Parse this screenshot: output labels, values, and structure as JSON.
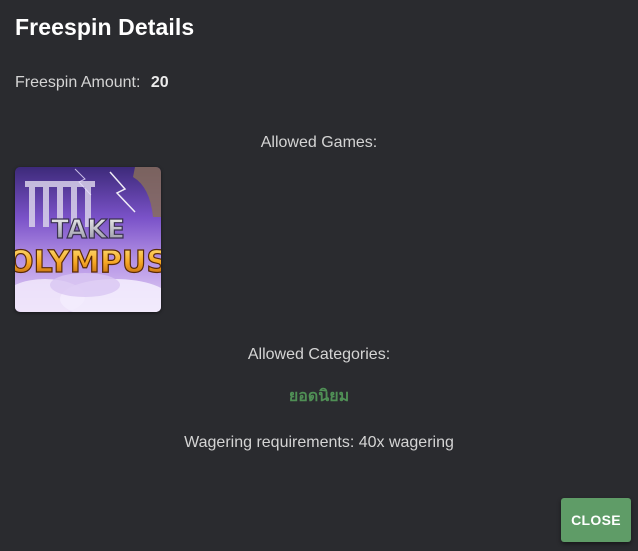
{
  "modal": {
    "title": "Freespin Details",
    "amount_label": "Freespin Amount:",
    "amount_value": "20",
    "allowed_games_label": "Allowed Games:",
    "games": [
      {
        "logo_line1": "TAKE",
        "logo_line2": "OLYMPUS",
        "icon": "game-thumbnail-take-olympus"
      }
    ],
    "allowed_categories_label": "Allowed Categories:",
    "category_value": "ยอดนิยม",
    "wagering_text": "Wagering requirements: 40x wagering",
    "close_label": "CLOSE"
  },
  "colors": {
    "background": "#2a2b2f",
    "accent_green": "#5f9c67",
    "category_green": "#4f8f55"
  }
}
